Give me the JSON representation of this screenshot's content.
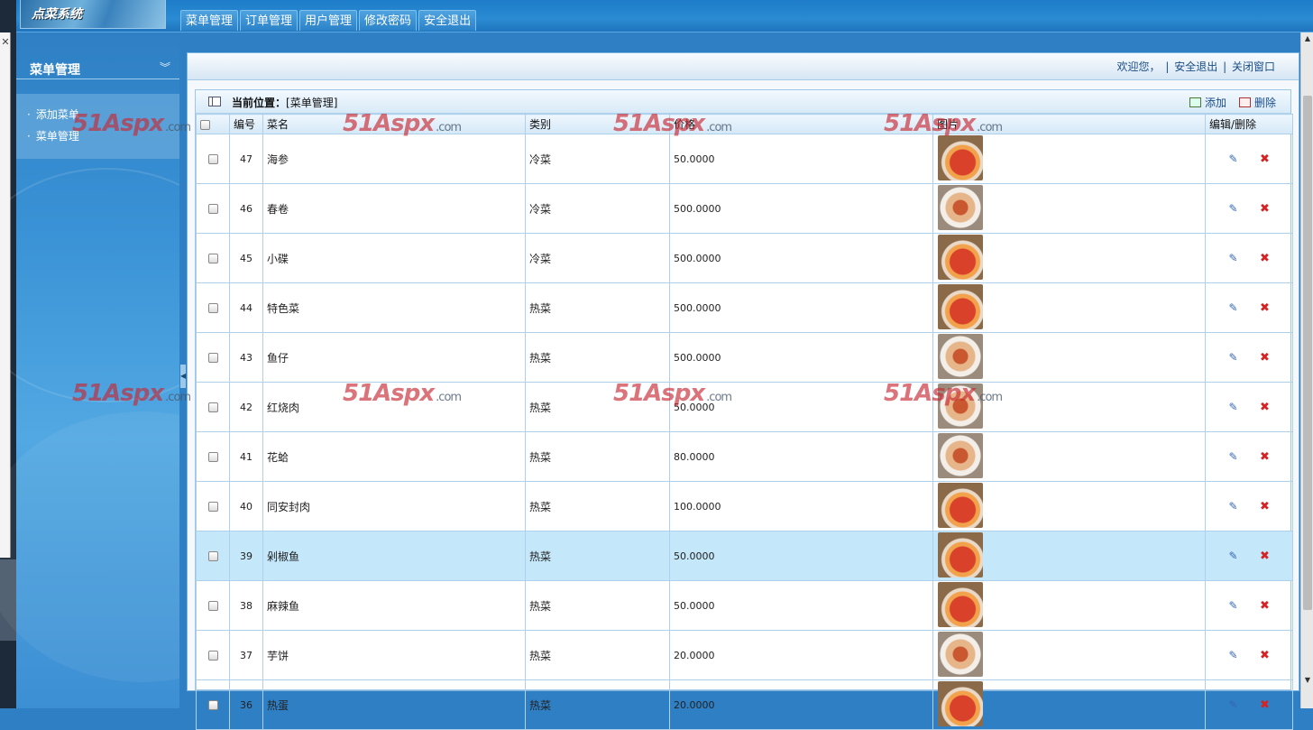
{
  "app": {
    "logo": "点菜系统"
  },
  "nav": [
    "菜单管理",
    "订单管理",
    "用户管理",
    "修改密码",
    "安全退出"
  ],
  "sidebar": {
    "title": "菜单管理",
    "collapse_icon": "double-chevron-down-icon",
    "items": [
      "添加菜单",
      "菜单管理"
    ]
  },
  "welcome": {
    "text": "欢迎您，",
    "logout": "安全退出",
    "close": "关闭窗口"
  },
  "panel": {
    "location_label": "当前位置：",
    "location_value": "[菜单管理]",
    "add": "添加",
    "delete": "删除"
  },
  "table": {
    "headers": [
      "编号",
      "菜名",
      "类别",
      "价格",
      "图片",
      "编辑/删除"
    ],
    "rows": [
      {
        "id": "47",
        "name": "海参",
        "category": "冷菜",
        "price": "50.0000"
      },
      {
        "id": "46",
        "name": "春卷",
        "category": "冷菜",
        "price": "500.0000"
      },
      {
        "id": "45",
        "name": "小碟",
        "category": "冷菜",
        "price": "500.0000"
      },
      {
        "id": "44",
        "name": "特色菜",
        "category": "热菜",
        "price": "500.0000"
      },
      {
        "id": "43",
        "name": "鱼仔",
        "category": "热菜",
        "price": "500.0000"
      },
      {
        "id": "42",
        "name": "红烧肉",
        "category": "热菜",
        "price": "50.0000"
      },
      {
        "id": "41",
        "name": "花蛤",
        "category": "热菜",
        "price": "80.0000"
      },
      {
        "id": "40",
        "name": "同安封肉",
        "category": "热菜",
        "price": "100.0000"
      },
      {
        "id": "39",
        "name": "剁椒鱼",
        "category": "热菜",
        "price": "50.0000"
      },
      {
        "id": "38",
        "name": "麻辣鱼",
        "category": "热菜",
        "price": "50.0000"
      },
      {
        "id": "37",
        "name": "芋饼",
        "category": "热菜",
        "price": "20.0000"
      },
      {
        "id": "36",
        "name": "热蛋",
        "category": "热菜",
        "price": "20.0000"
      }
    ],
    "highlighted_row": "39"
  },
  "watermark": {
    "brand": "51Aspx",
    "suffix": ".com"
  },
  "colors": {
    "topbar": "#1e7cc9",
    "highlight_row": "#c4e7fa",
    "delete_icon": "#d62222",
    "edit_icon": "#3566b5"
  }
}
